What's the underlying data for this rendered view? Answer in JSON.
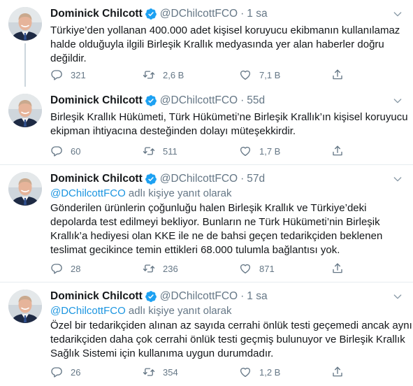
{
  "colors": {
    "accent": "#1da1f2",
    "mention": "#1b95e0",
    "text": "#14171a",
    "muted": "#657786",
    "border": "#e6ecf0"
  },
  "icons": {
    "verified": "verified-badge-icon",
    "reply": "reply-icon",
    "retweet": "retweet-icon",
    "like": "like-icon",
    "share": "share-icon",
    "more": "chevron-down-icon"
  },
  "tweets": [
    {
      "author": {
        "name": "Dominick Chilcott",
        "handle": "@DChilcottFCO"
      },
      "separator": "·",
      "time": "1 sa",
      "replying_to": null,
      "text_lines": [
        "Türkiye’den yollanan 400.000 adet kişisel koruyucu ekibmanın kullanılamaz",
        "halde olduğuyla ilgili Birleşik Krallık medyasında yer alan haberler doğru",
        "değildir."
      ],
      "stats": {
        "replies": "321",
        "retweets": "2,6 B",
        "likes": "7,1 B"
      }
    },
    {
      "author": {
        "name": "Dominick Chilcott",
        "handle": "@DChilcottFCO"
      },
      "separator": "·",
      "time": "55d",
      "replying_to": null,
      "text_lines": [
        "Birleşik Krallık Hükümeti, Türk Hükümeti’ne Birleşik Krallık’ın kişisel koruyucu",
        "ekipman ihtiyacına desteğinden dolayı müteşekkirdir."
      ],
      "stats": {
        "replies": "60",
        "retweets": "511",
        "likes": "1,7 B"
      }
    },
    {
      "author": {
        "name": "Dominick Chilcott",
        "handle": "@DChilcottFCO"
      },
      "separator": "·",
      "time": "57d",
      "replying_to": {
        "mention": "@DChilcottFCO",
        "suffix": "adlı kişiye yanıt olarak"
      },
      "text_lines": [
        "Gönderilen ürünlerin çoğunluğu halen Birleşik Krallık ve Türkiye’deki",
        "depolarda test edilmeyi bekliyor. Bunların ne Türk Hükümeti’nin Birleşik",
        "Krallık’a hediyesi olan KKE ile ne de bahsi geçen tedarikçiden beklenen",
        "teslimat gecikince temin ettikleri 68.000 tulumla bağlantısı yok."
      ],
      "stats": {
        "replies": "28",
        "retweets": "236",
        "likes": "871"
      }
    },
    {
      "author": {
        "name": "Dominick Chilcott",
        "handle": "@DChilcottFCO"
      },
      "separator": "·",
      "time": "1 sa",
      "replying_to": {
        "mention": "@DChilcottFCO",
        "suffix": "adlı kişiye yanıt olarak"
      },
      "text_lines": [
        "Özel bir tedarikçiden alınan az sayıda cerrahi önlük testi geçemedi ancak aynı",
        "tedarikçiden daha çok cerrahi önlük testi geçmiş bulunuyor ve Birleşik Krallık",
        "Sağlık Sistemi için kullanıma uygun durumdadır."
      ],
      "stats": {
        "replies": "26",
        "retweets": "354",
        "likes": "1,2 B"
      }
    }
  ]
}
